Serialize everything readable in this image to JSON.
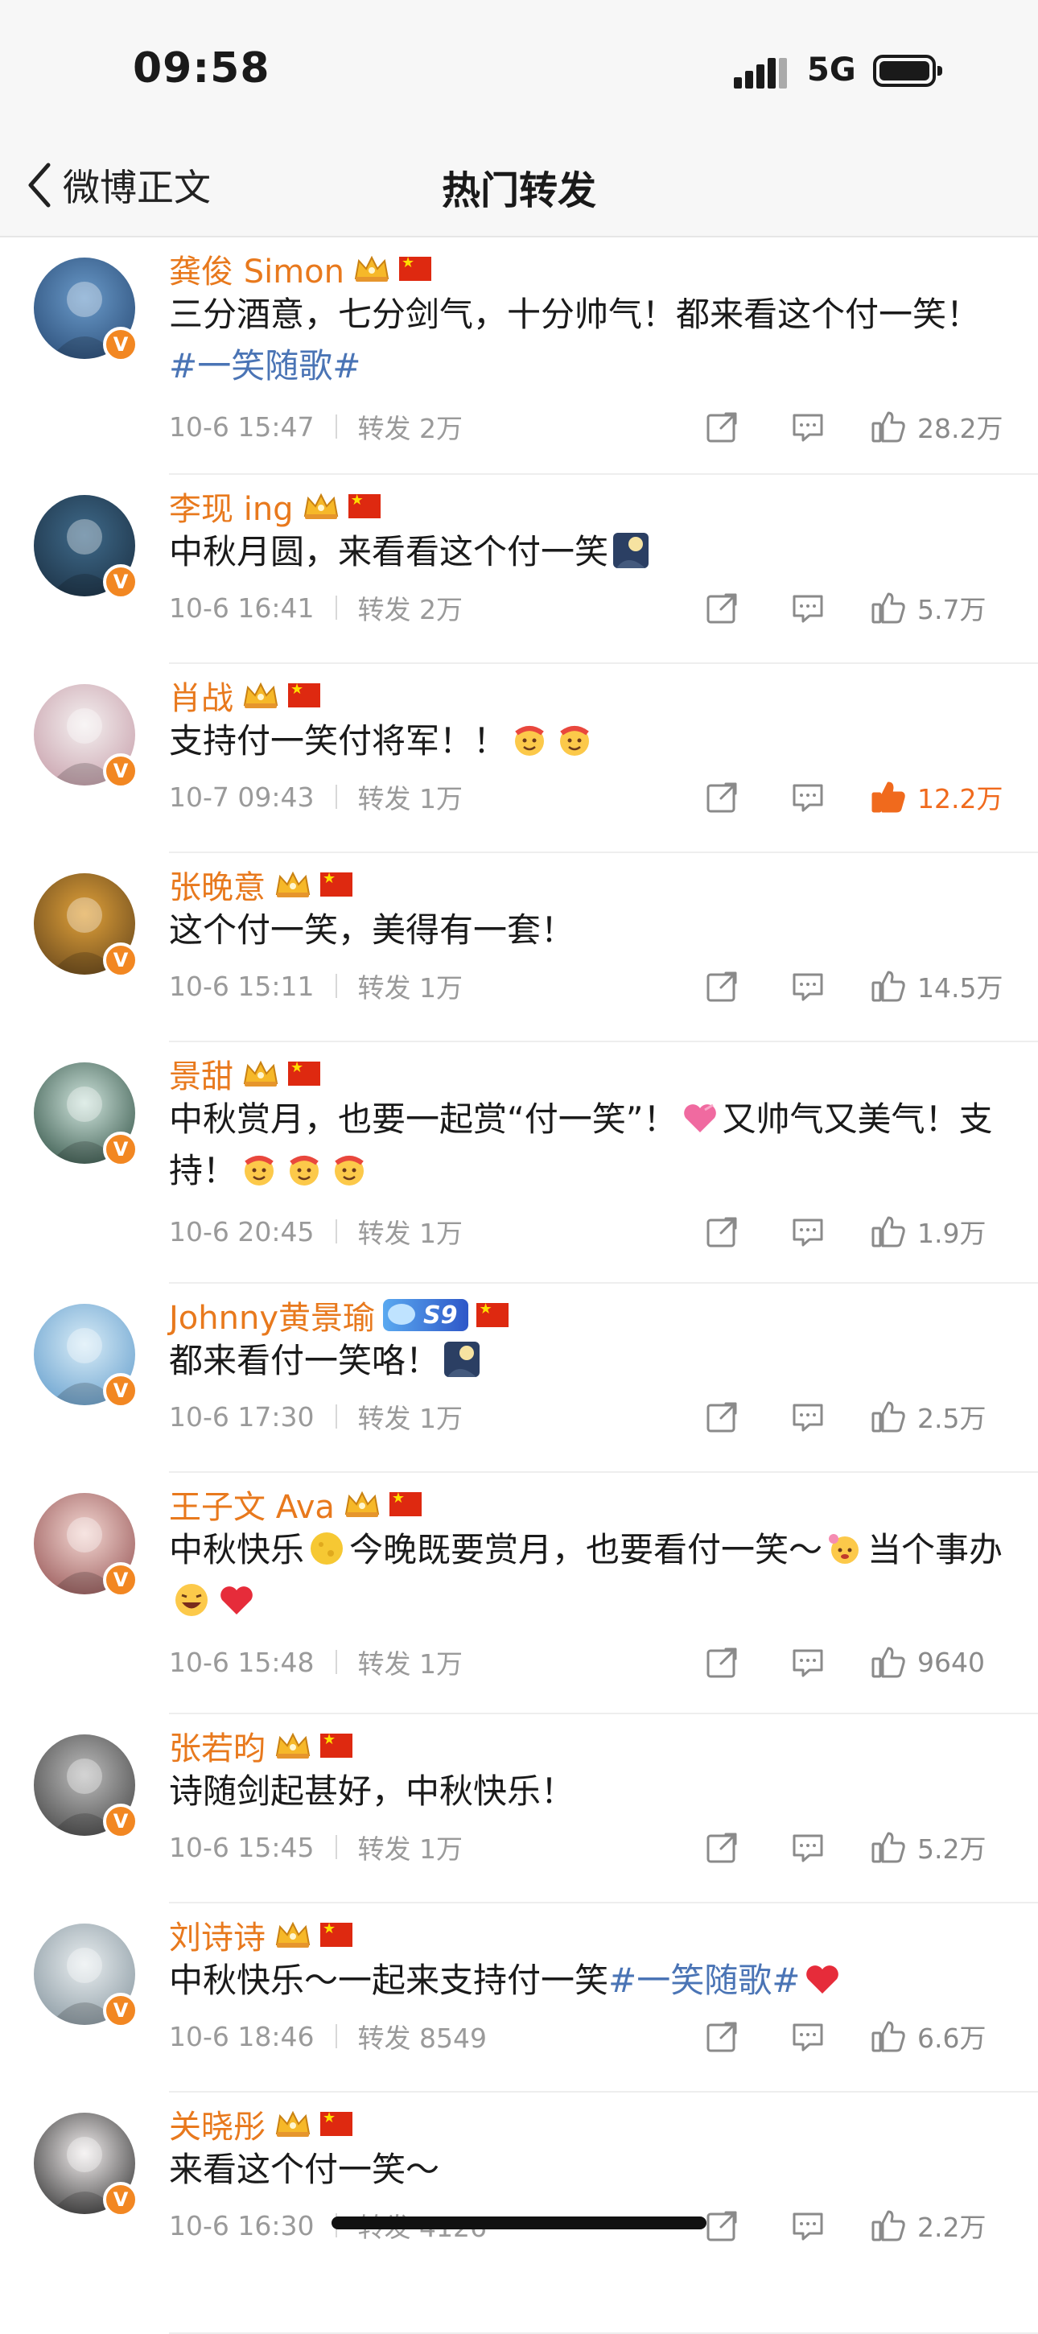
{
  "status_bar": {
    "time": "09:58",
    "network": "5G"
  },
  "nav": {
    "back_label": "微博正文",
    "title": "热门转发"
  },
  "posts": [
    {
      "name": "龚俊 Simon",
      "text_html": "三分酒意，七分剑气，十分帅气！都来看这个付一笑！<span class='tag'>#一笑随歌#</span>",
      "time": "10-6 15:47",
      "repost": "转发 2万",
      "likes": "28.2万",
      "liked": false
    },
    {
      "name": "李现 ing",
      "text_html": "中秋月圆，来看看这个付一笑<span class='emo' data-emo='moon'></span>",
      "time": "10-6 16:41",
      "repost": "转发 2万",
      "likes": "5.7万",
      "liked": false
    },
    {
      "name": "肖战",
      "text_html": "支持付一笑付将军！！<span class='emo' data-emo='cheer'></span><span class='emo' data-emo='cheer'></span>",
      "time": "10-7 09:43",
      "repost": "转发 1万",
      "likes": "12.2万",
      "liked": true
    },
    {
      "name": "张晚意",
      "text_html": "这个付一笑，美得有一套！",
      "time": "10-6 15:11",
      "repost": "转发 1万",
      "likes": "14.5万",
      "liked": false
    },
    {
      "name": "景甜",
      "text_html": "中秋赏月，也要一起赏“付一笑”！<span class='emo' data-emo='heart2'></span>又帅气又美气！支持！<span class='emo' data-emo='cheer'></span><span class='emo' data-emo='cheer'></span><span class='emo' data-emo='cheer'></span>",
      "time": "10-6 20:45",
      "repost": "转发 1万",
      "likes": "1.9万",
      "liked": false
    },
    {
      "name": "Johnny黄景瑜",
      "text_html": "都来看付一笑咯！<span class='emo' data-emo='moon'></span>",
      "time": "10-6 17:30",
      "repost": "转发 1万",
      "likes": "2.5万",
      "liked": false
    },
    {
      "name": "王子文 Ava",
      "text_html": "中秋快乐<span class='emo' data-emo='yellowmoon'></span>今晚既要赏月，也要看付一笑～<span class='emo' data-emo='flower'></span>当个事办<span class='emo' data-emo='laugh'></span><span class='emo' data-emo='heart'></span>",
      "time": "10-6 15:48",
      "repost": "转发 1万",
      "likes": "9640",
      "liked": false
    },
    {
      "name": "张若昀",
      "text_html": "诗随剑起甚好，中秋快乐！",
      "time": "10-6 15:45",
      "repost": "转发 1万",
      "likes": "5.2万",
      "liked": false
    },
    {
      "name": "刘诗诗",
      "text_html": "中秋快乐～一起来支持付一笑<span class='tag'>#一笑随歌#</span><span class='emo' data-emo='heart'></span>",
      "time": "10-6 18:46",
      "repost": "转发 8549",
      "likes": "6.6万",
      "liked": false
    },
    {
      "name": "关晓彤",
      "text_html": "来看这个付一笑～",
      "time": "10-6 16:30",
      "repost": "转发 4126",
      "likes": "2.2万",
      "liked": false
    }
  ],
  "colors": {
    "name": "#e8791d",
    "tag": "#4a74b5",
    "liked": "#f06a1d",
    "badge": "#f28722"
  }
}
